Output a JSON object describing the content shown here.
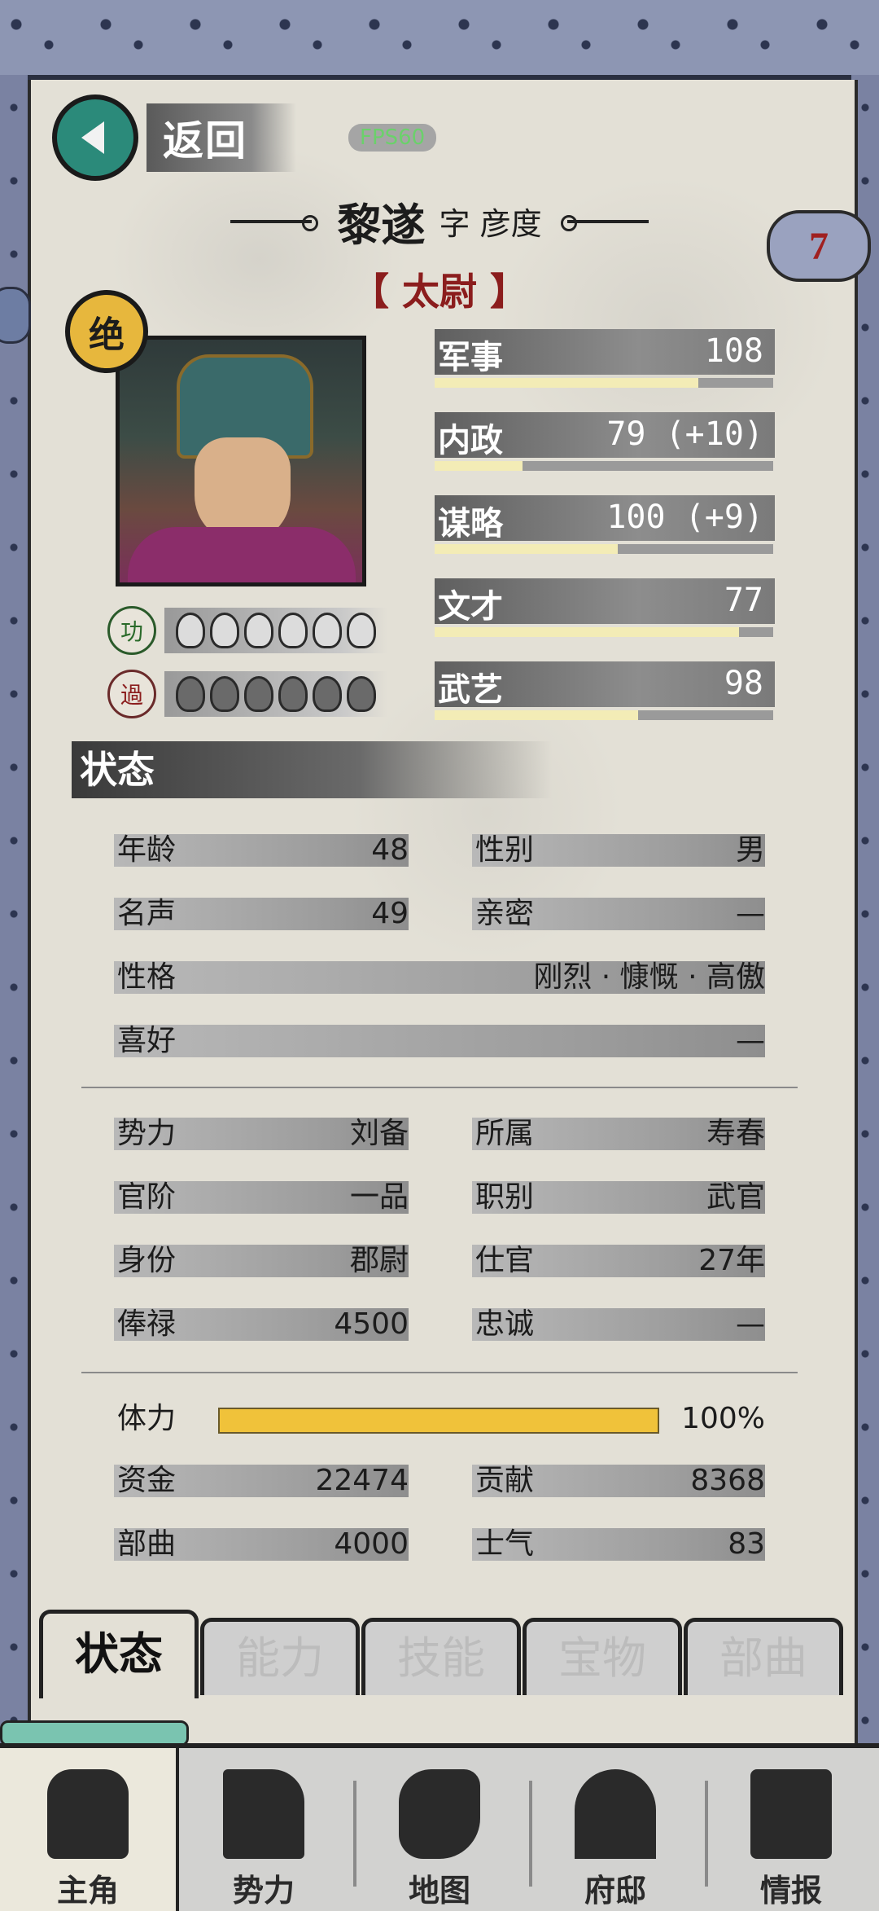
{
  "header": {
    "back_label": "返回",
    "fps": "FPS60",
    "name": "黎遂",
    "style_name": "字 彦度",
    "title": "【 太尉 】",
    "rank_badge": "7"
  },
  "portrait": {
    "grade_badge": "绝"
  },
  "merit": {
    "label": "功",
    "filled": 6,
    "total": 6
  },
  "demerit": {
    "label": "過",
    "filled": 6,
    "total": 6
  },
  "abilities": [
    {
      "label": "军事",
      "value": "108",
      "bonus": "",
      "level": 0.78
    },
    {
      "label": "内政",
      "value": "79",
      "bonus": "(+10)",
      "level": 0.26
    },
    {
      "label": "谋略",
      "value": "100",
      "bonus": "(+9)",
      "level": 0.54
    },
    {
      "label": "文才",
      "value": "77",
      "bonus": "",
      "level": 0.9
    },
    {
      "label": "武艺",
      "value": "98",
      "bonus": "",
      "level": 0.6
    }
  ],
  "status": {
    "section_title": "状态",
    "age_label": "年龄",
    "age": "48",
    "gender_label": "性别",
    "gender": "男",
    "fame_label": "名声",
    "fame": "49",
    "intimacy_label": "亲密",
    "intimacy": "—",
    "personality_label": "性格",
    "personality": "刚烈 · 慷慨 · 高傲",
    "hobby_label": "喜好",
    "hobby": "—",
    "force_label": "势力",
    "force": "刘备",
    "belong_label": "所属",
    "belong": "寿春",
    "rank_label": "官阶",
    "rank": "一品",
    "job_label": "职别",
    "job": "武官",
    "identity_label": "身份",
    "identity": "郡尉",
    "service_label": "仕官",
    "service": "27年",
    "salary_label": "俸禄",
    "salary": "4500",
    "loyalty_label": "忠诚",
    "loyalty": "—",
    "stamina_label": "体力",
    "stamina": "100%",
    "stamina_level": 1.0,
    "funds_label": "资金",
    "funds": "22474",
    "contribution_label": "贡献",
    "contribution": "8368",
    "troops_label": "部曲",
    "troops": "4000",
    "morale_label": "士气",
    "morale": "83"
  },
  "tabs": [
    "状态",
    "能力",
    "技能",
    "宝物",
    "部曲"
  ],
  "bottom_nav": [
    "主角",
    "势力",
    "地图",
    "府邸",
    "情报"
  ]
}
